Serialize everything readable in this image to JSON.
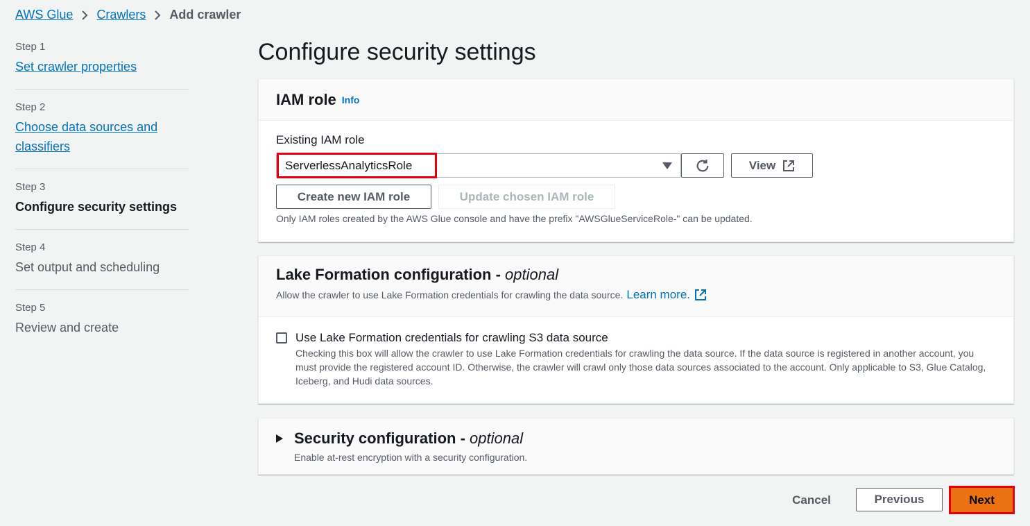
{
  "breadcrumb": {
    "items": [
      "AWS Glue",
      "Crawlers"
    ],
    "current": "Add crawler"
  },
  "steps": [
    {
      "num": "Step 1",
      "label": "Set crawler properties",
      "state": "link"
    },
    {
      "num": "Step 2",
      "label": "Choose data sources and classifiers",
      "state": "link"
    },
    {
      "num": "Step 3",
      "label": "Configure security settings",
      "state": "current"
    },
    {
      "num": "Step 4",
      "label": "Set output and scheduling",
      "state": "disabled"
    },
    {
      "num": "Step 5",
      "label": "Review and create",
      "state": "disabled"
    }
  ],
  "page_title": "Configure security settings",
  "iam": {
    "title": "IAM role",
    "info": "Info",
    "field_label": "Existing IAM role",
    "selected_role": "ServerlessAnalyticsRole",
    "view_label": "View",
    "create_label": "Create new IAM role",
    "update_label": "Update chosen IAM role",
    "help_text": "Only IAM roles created by the AWS Glue console and have the prefix \"AWSGlueServiceRole-\" can be updated."
  },
  "lake": {
    "title": "Lake Formation configuration - ",
    "title_optional": "optional",
    "description": "Allow the crawler to use Lake Formation credentials for crawling the data source.",
    "learn_more": "Learn more.",
    "checkbox_label": "Use Lake Formation credentials for crawling S3 data source",
    "checkbox_checked": false,
    "checkbox_desc": "Checking this box will allow the crawler to use Lake Formation credentials for crawling the data source. If the data source is registered in another account, you must provide the registered account ID. Otherwise, the crawler will crawl only those data sources associated to the account. Only applicable to S3, Glue Catalog, Iceberg, and Hudi data sources."
  },
  "security": {
    "title": "Security configuration - ",
    "title_optional": "optional",
    "description": "Enable at-rest encryption with a security configuration."
  },
  "footer": {
    "cancel": "Cancel",
    "previous": "Previous",
    "next": "Next"
  },
  "colors": {
    "link": "#0073bb",
    "primary_button": "#ec7211",
    "highlight": "#e3000f"
  }
}
